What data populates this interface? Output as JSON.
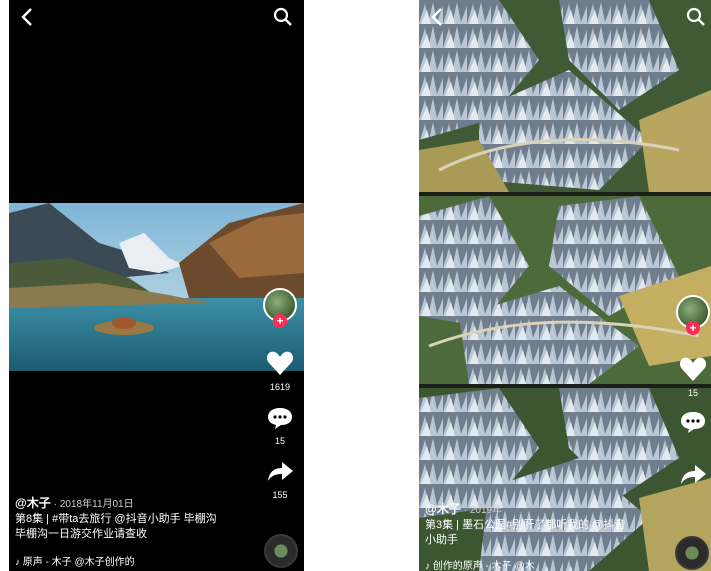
{
  "left": {
    "username": "@木子",
    "date": "· 2018年11月01日",
    "caption_line1": "第8集 | #带ta去旅行 @抖音小助手 毕棚沟",
    "caption_line2": "毕棚沟一日游交作业请查收",
    "music": "原声 - 木子  @木子创作的",
    "like_count": "1619",
    "comment_count": "15",
    "share_count": "155",
    "follow_symbol": "+"
  },
  "right": {
    "username": "@木子",
    "date": "· 2019年",
    "caption_line1": "第3集 | 墨石公园#别肝了都听我的 @抖音",
    "caption_line2": "小助手",
    "music": "创作的原声 - 木子  @木",
    "like_count": "15",
    "comment_count": "",
    "share_count": "",
    "follow_symbol": "+"
  },
  "icons": [
    "back-icon",
    "search-icon",
    "heart-icon",
    "comment-icon",
    "share-icon",
    "music-note-icon",
    "music-disc-icon"
  ],
  "colors": {
    "follow_badge": "#fe2c55",
    "background": "#000000"
  }
}
